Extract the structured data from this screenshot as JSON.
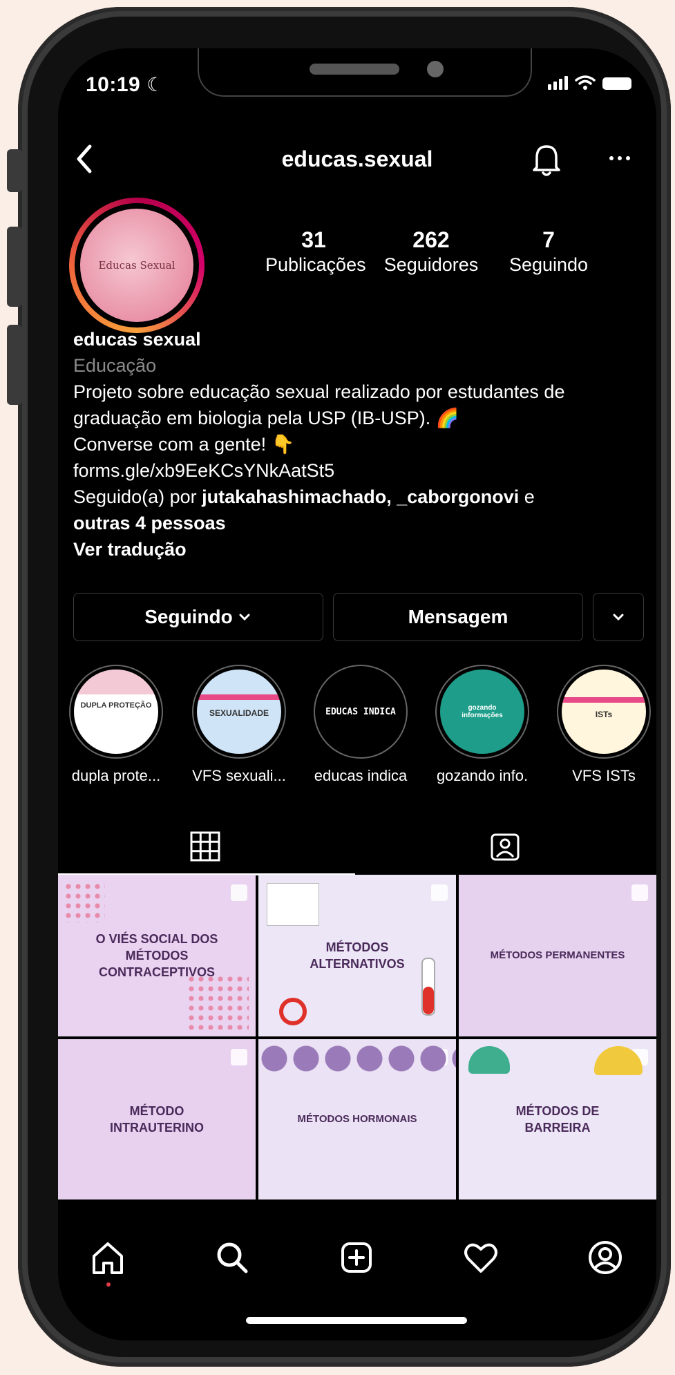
{
  "status": {
    "time": "10:19"
  },
  "header": {
    "username": "educas.sexual"
  },
  "profile": {
    "avatar_text": "Educas Sexual",
    "stats": [
      {
        "value": "31",
        "label": "Publicações"
      },
      {
        "value": "262",
        "label": "Seguidores"
      },
      {
        "value": "7",
        "label": "Seguindo"
      }
    ],
    "name": "educas sexual",
    "category": "Educação",
    "bio_line1": "Projeto sobre educação sexual realizado por estudantes de",
    "bio_line2": "graduação em biologia pela USP (IB-USP). 🌈",
    "bio_line3": "Converse com a gente! 👇",
    "link": "forms.gle/xb9EeKCsYNkAatSt5",
    "followed_prefix": "Seguido(a) por ",
    "followed_names": "jutakahashimachado, _caborgonovi",
    "followed_mid": " e",
    "followed_others": "outras 4 pessoas",
    "translate": "Ver tradução"
  },
  "actions": {
    "following_label": "Seguindo",
    "message_label": "Mensagem"
  },
  "highlights": [
    {
      "label": "dupla prote...",
      "cover": "DUPLA PROTEÇÃO"
    },
    {
      "label": "VFS sexuali...",
      "cover": "SEXUALIDADE"
    },
    {
      "label": "educas indica",
      "cover": "EDUCAS INDICA"
    },
    {
      "label": "gozando info.",
      "cover": "gozando informações"
    },
    {
      "label": "VFS ISTs",
      "cover": "ISTs"
    }
  ],
  "posts": [
    {
      "title": "O VIÉS SOCIAL DOS MÉTODOS CONTRACEPTIVOS",
      "bg": "#e9d3f0"
    },
    {
      "title": "MÉTODOS ALTERNATIVOS",
      "bg": "#ece6f6"
    },
    {
      "title": "MÉTODOS PERMANENTES",
      "bg": "#e6d2ef"
    },
    {
      "title": "MÉTODO INTRAUTERINO",
      "bg": "#e8d1ef"
    },
    {
      "title": "MÉTODOS HORMONAIS",
      "bg": "#ebe3f5"
    },
    {
      "title": "MÉTODOS DE BARREIRA",
      "bg": "#ece6f6"
    }
  ],
  "colors": {
    "accent_red": "#e53a4a",
    "divider": "#3a3a3a",
    "muted": "#8a8a8a"
  }
}
